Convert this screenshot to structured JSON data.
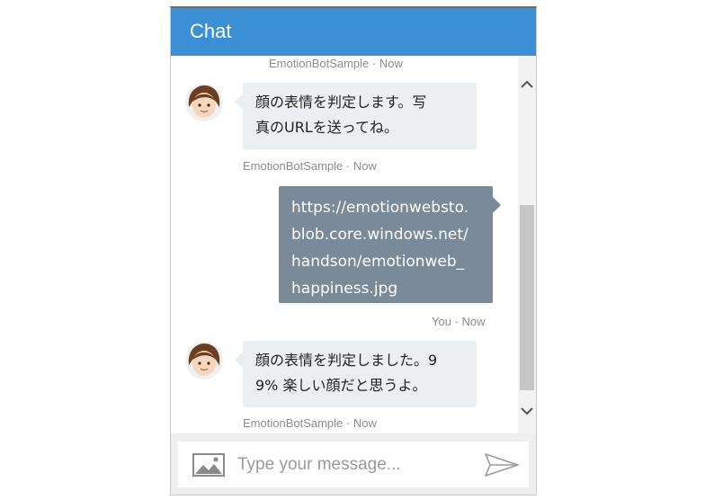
{
  "header": {
    "title": "Chat"
  },
  "messages": [
    {
      "sender": "bot",
      "meta": "EmotionBotSample · Now",
      "lines": [
        "顔の表情を判定します。写",
        "真のURLを送ってね。"
      ]
    },
    {
      "sender": "user",
      "meta": "You · Now",
      "lines": [
        "https://emotionwebsto.",
        "blob.core.windows.net/",
        "handson/emotionweb_",
        "happiness.jpg"
      ]
    },
    {
      "sender": "bot",
      "meta": "EmotionBotSample · Now",
      "lines": [
        "顔の表情を判定しました。9",
        "9% 楽しい顔だと思うよ。"
      ]
    }
  ],
  "top_meta": "EmotionBotSample · Now",
  "input": {
    "placeholder": "Type your message..."
  },
  "icons": {
    "avatar": "avatar-icon",
    "upload": "image-upload-icon",
    "send": "send-icon",
    "scroll_up": "chevron-up-icon",
    "scroll_down": "chevron-down-icon"
  },
  "colors": {
    "header": "#3a8fd5",
    "bot_bubble": "#eceff1",
    "user_bubble": "#7a8a99",
    "meta_text": "#8c8c8c"
  }
}
